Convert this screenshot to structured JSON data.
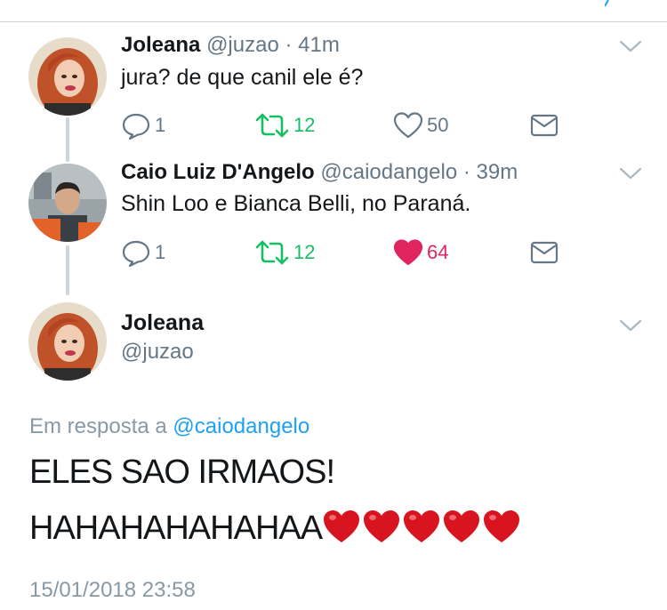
{
  "thread": [
    {
      "name": "Joleana",
      "handle": "@juzao",
      "separator": "·",
      "time": "41m",
      "text": "jura? de que canil ele é?",
      "replies": "1",
      "retweets": "12",
      "likes": "50",
      "liked": false,
      "avatar_icon": "avatar-photo-redhead"
    },
    {
      "name": "Caio Luiz D'Angelo",
      "handle": "@caiodangelo",
      "separator": "·",
      "time": "39m",
      "text": "Shin Loo e Bianca Belli, no Paraná.",
      "replies": "1",
      "retweets": "12",
      "likes": "64",
      "liked": true,
      "avatar_icon": "avatar-photo-man"
    }
  ],
  "main_tweet": {
    "name": "Joleana",
    "handle": "@juzao",
    "reply_prefix": "Em resposta a",
    "reply_mention": "@caiodangelo",
    "line1": "ELES SAO IRMAOS!",
    "line2": "HAHAHAHAHAHAA",
    "heart_emoji_count": 5,
    "timestamp": "15/01/2018 23:58"
  },
  "colors": {
    "retweet_green": "#17bf63",
    "like_red": "#e0245e",
    "link_blue": "#1da1f2",
    "secondary_grey": "#657786"
  },
  "icons": [
    "reply-icon",
    "retweet-icon",
    "like-icon",
    "dm-icon",
    "chevron-down-icon",
    "heart-emoji"
  ]
}
